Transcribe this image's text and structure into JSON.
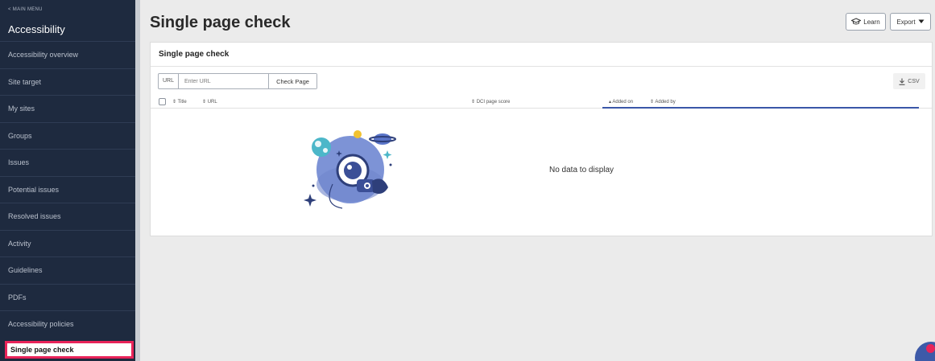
{
  "sidebar": {
    "back_label": "< MAIN MENU",
    "title": "Accessibility",
    "items": [
      {
        "label": "Accessibility overview"
      },
      {
        "label": "Site target"
      },
      {
        "label": "My sites"
      },
      {
        "label": "Groups"
      },
      {
        "label": "Issues"
      },
      {
        "label": "Potential issues"
      },
      {
        "label": "Resolved issues"
      },
      {
        "label": "Activity"
      },
      {
        "label": "Guidelines"
      },
      {
        "label": "PDFs"
      },
      {
        "label": "Accessibility policies"
      },
      {
        "label": "Single page check"
      }
    ]
  },
  "header": {
    "title": "Single page check",
    "learn_label": "Learn",
    "export_label": "Export"
  },
  "card": {
    "title": "Single page check",
    "url_prefix": "URL",
    "url_placeholder": "Enter URL",
    "check_label": "Check Page",
    "csv_label": "CSV",
    "columns": [
      "Title",
      "URL",
      "DCI page score",
      "Added on",
      "Added by"
    ],
    "empty_message": "No data to display"
  },
  "colors": {
    "sidebar_bg": "#1e2a3f",
    "active_outline": "#e8245a",
    "accent": "#3a57a8"
  },
  "icons": [
    "chevron-left-icon",
    "graduation-cap-icon",
    "caret-down-icon",
    "download-icon",
    "sort-icon",
    "astronaut-illustration",
    "chat-icon"
  ]
}
